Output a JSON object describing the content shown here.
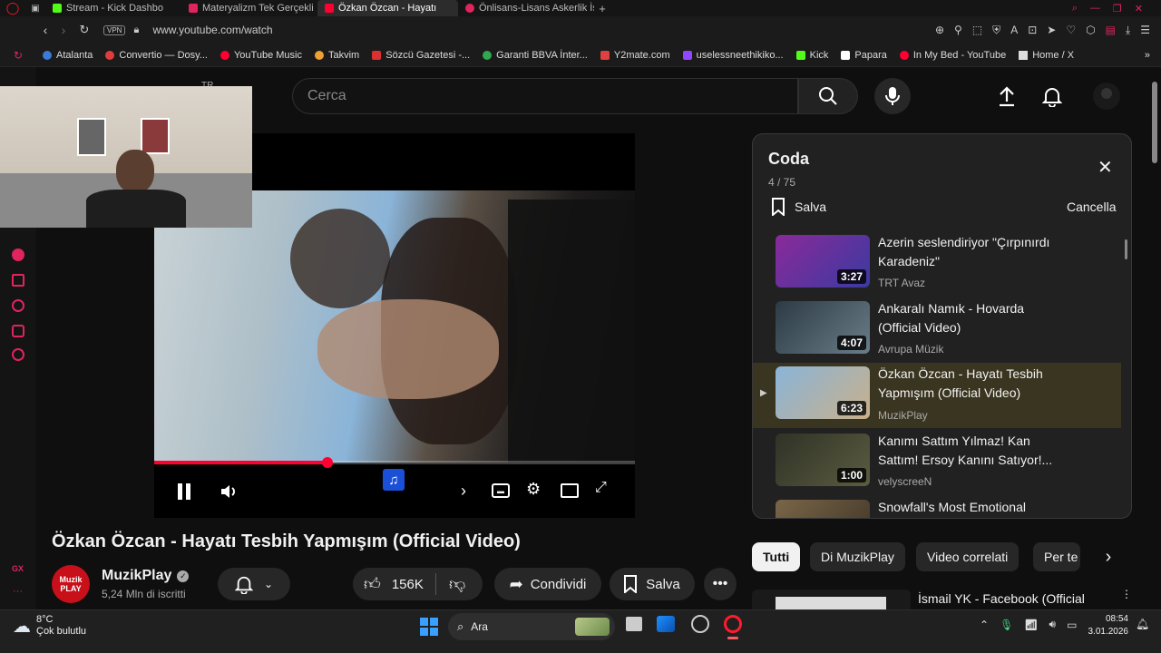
{
  "browser": {
    "tabs": [
      {
        "label": "Stream - Kick Dashbo",
        "color": "#53fc18"
      },
      {
        "label": "Materyalizm Tek Gerçekli",
        "color": "#e0245e"
      },
      {
        "label": "Özkan Özcan - Hayatı",
        "color": "#ff0033"
      },
      {
        "label": "Önlisans-Lisans Askerlik İş",
        "color": "#e0245e"
      }
    ],
    "vpn": "VPN",
    "url": "www.youtube.com/watch",
    "bookmarks": [
      {
        "label": "Atalanta",
        "color": "#3a7bd5"
      },
      {
        "label": "Convertio — Dosy...",
        "color": "#e03c3c"
      },
      {
        "label": "YouTube Music",
        "color": "#ff0033"
      },
      {
        "label": "Takvim",
        "color": "#f0a030"
      },
      {
        "label": "Sözcü Gazetesi -...",
        "color": "#d93030"
      },
      {
        "label": "Garanti BBVA İnter...",
        "color": "#2fa84f"
      },
      {
        "label": "Y2mate.com",
        "color": "#e04040"
      },
      {
        "label": "uselessneethikiko...",
        "color": "#9146ff"
      },
      {
        "label": "Kick",
        "color": "#53fc18"
      },
      {
        "label": "Papara",
        "color": "#ffffff"
      },
      {
        "label": "In My Bed - YouTube",
        "color": "#ff0033"
      },
      {
        "label": "Home / X",
        "color": "#dddddd"
      }
    ]
  },
  "youtube": {
    "country": "TR",
    "search_placeholder": "Cerca",
    "video_title": "Özkan Özcan - Hayatı Tesbih Yapmışım (Official Video)",
    "progress": 0.36,
    "channel": {
      "name": "MuzikPlay",
      "subscribers": "5,24 Mln di iscritti",
      "logo_text": "Muzik PLAY"
    },
    "actions": {
      "likes": "156K",
      "share": "Condividi",
      "save": "Salva"
    },
    "queue": {
      "title": "Coda",
      "position": "4 / 75",
      "save": "Salva",
      "clear": "Cancella",
      "items": [
        {
          "title": "Azerin seslendiriyor \"Çırpınırdı Karadeniz\"",
          "channel": "TRT Avaz",
          "duration": "3:27",
          "thumb": "#7a2a8c"
        },
        {
          "title": "Ankaralı Namık - Hovarda (Official Video)",
          "channel": "Avrupa Müzik",
          "duration": "4:07",
          "thumb": "#3b4a55"
        },
        {
          "title": "Özkan Özcan - Hayatı Tesbih Yapmışım (Official Video)",
          "channel": "MuzikPlay",
          "duration": "6:23",
          "thumb": "#6a8fa8",
          "current": true
        },
        {
          "title": "Kanımı Sattım Yılmaz! Kan Sattım! Ersoy Kanını Satıyor!...",
          "channel": "velyscreeN",
          "duration": "1:00",
          "thumb": "#3d4030"
        },
        {
          "title": "Snowfall's Most Emotional",
          "channel": "",
          "duration": "",
          "thumb": "#6b5a40"
        }
      ]
    },
    "chips": [
      "Tutti",
      "Di MuzikPlay",
      "Video correlati",
      "Per te"
    ],
    "next_video": "İsmail YK - Facebook (Official"
  },
  "taskbar": {
    "weather_temp": "8°C",
    "weather_desc": "Çok bulutlu",
    "search": "Ara",
    "time": "08:54",
    "date": "3.01.2026"
  }
}
